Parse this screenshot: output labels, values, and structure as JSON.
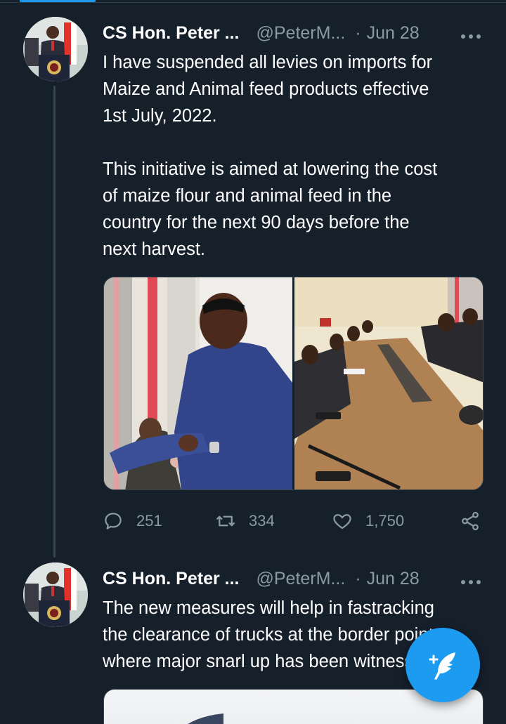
{
  "tabs": {
    "active_indicator_color": "#1d9bf0"
  },
  "tweets": [
    {
      "display_name": "CS Hon. Peter ...",
      "handle": "@PeterM...",
      "separator": "·",
      "date": "Jun 28",
      "more_icon": "more-horizontal-icon",
      "text": "I have suspended all levies on imports for\nMaize and Animal feed products effective\n1st July, 2022.\n\nThis initiative is aimed at lowering the cost\nof maize flour and animal feed in the\ncountry for the next 90 days before the\nnext harvest.",
      "media": [
        "photo-speaker-blue-shirt",
        "photo-meeting-room"
      ],
      "replies": "251",
      "retweets": "334",
      "likes": "1,750"
    },
    {
      "display_name": "CS Hon. Peter ...",
      "handle": "@PeterM...",
      "separator": "·",
      "date": "Jun 28",
      "more_icon": "more-horizontal-icon",
      "text": "The new measures will help in fastracking\nthe clearance of trucks at the border points\nwhere major snarl up has been witnessed"
    }
  ],
  "compose_button": {
    "icon": "compose-feather-icon",
    "color": "#1d9bf0"
  },
  "colors": {
    "background": "#15202b",
    "muted_text": "#8b98a5",
    "border": "#38444d",
    "accent": "#1d9bf0"
  }
}
